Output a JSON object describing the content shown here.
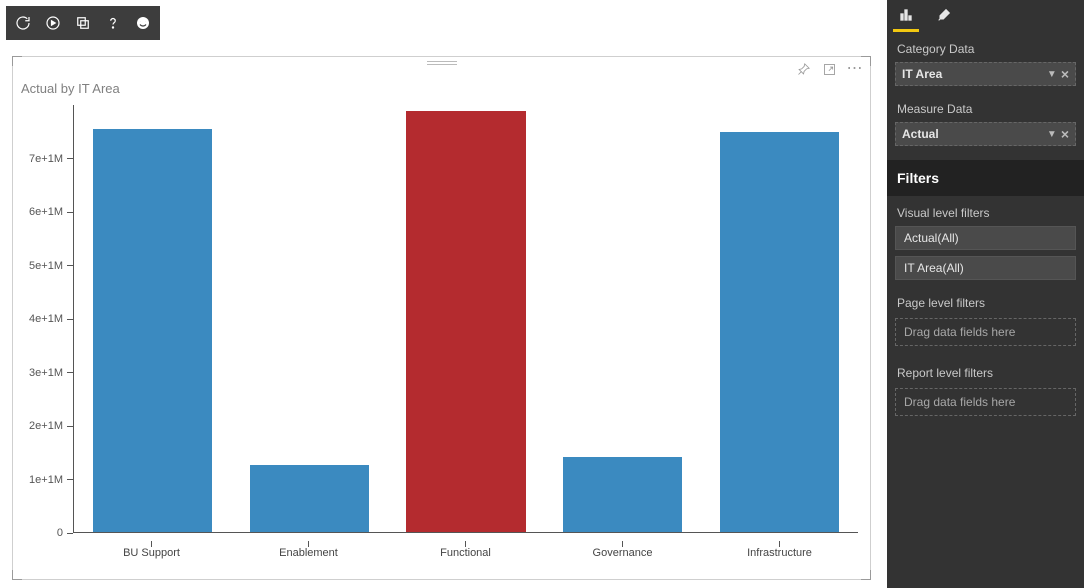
{
  "toolbar": {
    "buttons": [
      "refresh",
      "play",
      "copy",
      "help",
      "smiley"
    ]
  },
  "visual": {
    "title": "Actual by IT Area"
  },
  "chart_data": {
    "type": "bar",
    "title": "Actual by IT Area",
    "xlabel": "",
    "ylabel": "",
    "categories": [
      "BU Support",
      "Enablement",
      "Functional",
      "Governance",
      "Infrastructure"
    ],
    "values": [
      7550000,
      1250000,
      7880000,
      1400000,
      7490000
    ],
    "highlight_index": 2,
    "ylim": [
      0,
      8000000
    ],
    "y_ticks": [
      0,
      1000000,
      2000000,
      3000000,
      4000000,
      5000000,
      6000000,
      7000000
    ],
    "y_tick_labels": [
      "0",
      "1e+1M",
      "2e+1M",
      "3e+1M",
      "4e+1M",
      "5e+1M",
      "6e+1M",
      "7e+1M"
    ],
    "colors": {
      "default": "#3b8ac0",
      "highlight": "#b42b2f"
    }
  },
  "panel": {
    "category_section": "Category Data",
    "category_field": "IT Area",
    "measure_section": "Measure Data",
    "measure_field": "Actual",
    "filters_header": "Filters",
    "visual_level_label": "Visual level filters",
    "visual_filters": [
      "Actual(All)",
      "IT Area(All)"
    ],
    "page_level_label": "Page level filters",
    "report_level_label": "Report level filters",
    "drop_hint": "Drag data fields here"
  }
}
